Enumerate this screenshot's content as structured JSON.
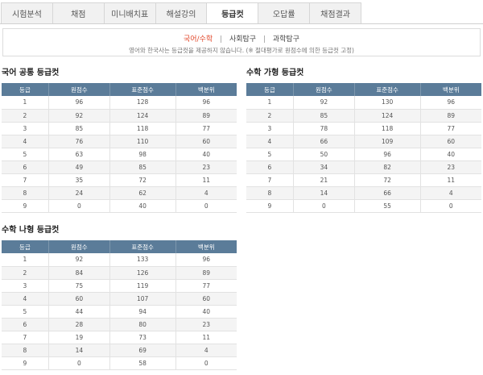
{
  "tabs": [
    {
      "label": "시험분석",
      "active": false
    },
    {
      "label": "채점",
      "active": false
    },
    {
      "label": "미니배치표",
      "active": false
    },
    {
      "label": "해설강의",
      "active": false
    },
    {
      "label": "등급컷",
      "active": true
    },
    {
      "label": "오답률",
      "active": false
    },
    {
      "label": "채점결과",
      "active": false
    }
  ],
  "subnav": {
    "items": [
      {
        "label": "국어/수학",
        "active": true
      },
      {
        "label": "사회탐구",
        "active": false
      },
      {
        "label": "과학탐구",
        "active": false
      }
    ],
    "separator": "|",
    "note": "영어와 한국사는 등급컷을 제공하지 않습니다. (※ 절대평가로 원점수에 의한 등급컷 고정)"
  },
  "columns": [
    "등급",
    "원점수",
    "표준점수",
    "백분위"
  ],
  "accent_color": "#e2492c",
  "header_color": "#5b7c99",
  "sections": [
    {
      "title": "국어 공통 등급컷",
      "rows": [
        [
          "1",
          "96",
          "128",
          "96"
        ],
        [
          "2",
          "92",
          "124",
          "89"
        ],
        [
          "3",
          "85",
          "118",
          "77"
        ],
        [
          "4",
          "76",
          "110",
          "60"
        ],
        [
          "5",
          "63",
          "98",
          "40"
        ],
        [
          "6",
          "49",
          "85",
          "23"
        ],
        [
          "7",
          "35",
          "72",
          "11"
        ],
        [
          "8",
          "24",
          "62",
          "4"
        ],
        [
          "9",
          "0",
          "40",
          "0"
        ]
      ]
    },
    {
      "title": "수학 가형 등급컷",
      "rows": [
        [
          "1",
          "92",
          "130",
          "96"
        ],
        [
          "2",
          "85",
          "124",
          "89"
        ],
        [
          "3",
          "78",
          "118",
          "77"
        ],
        [
          "4",
          "66",
          "109",
          "60"
        ],
        [
          "5",
          "50",
          "96",
          "40"
        ],
        [
          "6",
          "34",
          "82",
          "23"
        ],
        [
          "7",
          "21",
          "72",
          "11"
        ],
        [
          "8",
          "14",
          "66",
          "4"
        ],
        [
          "9",
          "0",
          "55",
          "0"
        ]
      ]
    },
    {
      "title": "수학 나형 등급컷",
      "rows": [
        [
          "1",
          "92",
          "133",
          "96"
        ],
        [
          "2",
          "84",
          "126",
          "89"
        ],
        [
          "3",
          "75",
          "119",
          "77"
        ],
        [
          "4",
          "60",
          "107",
          "60"
        ],
        [
          "5",
          "44",
          "94",
          "40"
        ],
        [
          "6",
          "28",
          "80",
          "23"
        ],
        [
          "7",
          "19",
          "73",
          "11"
        ],
        [
          "8",
          "14",
          "69",
          "4"
        ],
        [
          "9",
          "0",
          "58",
          "0"
        ]
      ]
    }
  ]
}
